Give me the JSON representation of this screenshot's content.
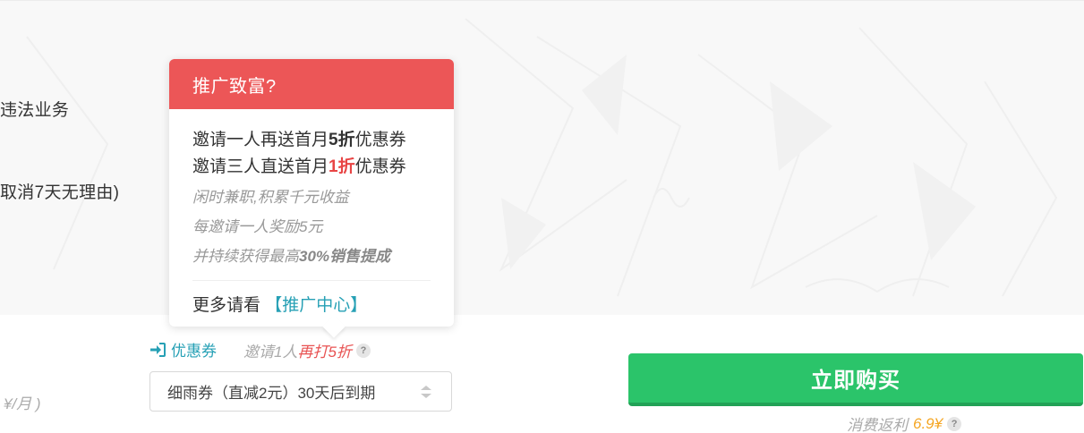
{
  "background": {
    "fragment_1": "违法业务",
    "fragment_2": "取消7天无理由)",
    "price_fragment": "¥/月 )"
  },
  "popup": {
    "title": "推广致富?",
    "line1_prefix": "邀请一人再送首月",
    "line1_highlight": "5折",
    "line1_suffix": "优惠券",
    "line2_prefix": "邀请三人直送首月",
    "line2_highlight": "1折",
    "line2_suffix": "优惠券",
    "sub1": "闲时兼职,积累千元收益",
    "sub2": "每邀请一人奖励5元",
    "sub3_prefix": "并持续获得最高",
    "sub3_bold": "30%销售提成",
    "footer_prefix": "更多请看",
    "footer_link": "【推广中心】"
  },
  "coupon": {
    "link_label": "优惠券",
    "invite_prefix": "邀请1人",
    "invite_highlight": "再打5折",
    "help": "?",
    "selected": "细雨券（直减2元）30天后到期"
  },
  "purchase": {
    "button_label": "立即购买",
    "rebate_label": "消费返利",
    "rebate_amount": "6.9¥",
    "help": "?"
  },
  "colors": {
    "popup_header": "#ec5657",
    "accent_teal": "#26a0b5",
    "buy_green": "#2bc46a",
    "highlight_red": "#e84545",
    "rebate_orange": "#f5a623"
  },
  "icons": {
    "coupon_link": "sign-in-arrow-icon",
    "select_arrows": "sort-arrows-icon"
  }
}
